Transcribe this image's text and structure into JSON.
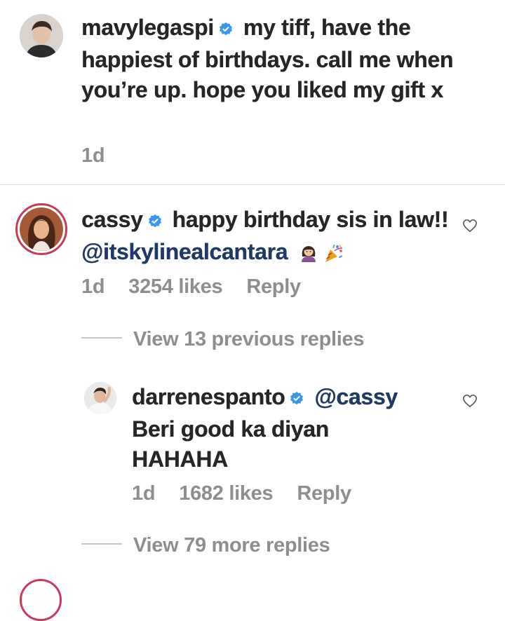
{
  "comments": [
    {
      "username": "mavylegaspi",
      "text": "my tiff, have the happiest of birthdays. call me when you’re up. hope you liked my gift x",
      "time": "1d"
    },
    {
      "username": "cassy",
      "text_before": "happy birthday sis in law!! ",
      "mention": "@itskylinealcantara",
      "time": "1d",
      "likes": "3254 likes",
      "reply_label": "Reply",
      "view_replies": "View 13 previous replies"
    }
  ],
  "replies": [
    {
      "username": "darrenespanto",
      "mention": "@cassy",
      "text": "Beri good ka diyan HAHAHA",
      "time": "1d",
      "likes": "1682 likes",
      "reply_label": "Reply",
      "view_replies": "View 79 more replies"
    }
  ],
  "colors": {
    "verified": "#3897f0",
    "mention": "#1f3a68",
    "meta": "#8e8e8e",
    "story_ring": "#c43b5b"
  },
  "icons": [
    "verified-badge-icon",
    "heart-icon",
    "woman-emoji-icon",
    "party-popper-emoji-icon"
  ]
}
